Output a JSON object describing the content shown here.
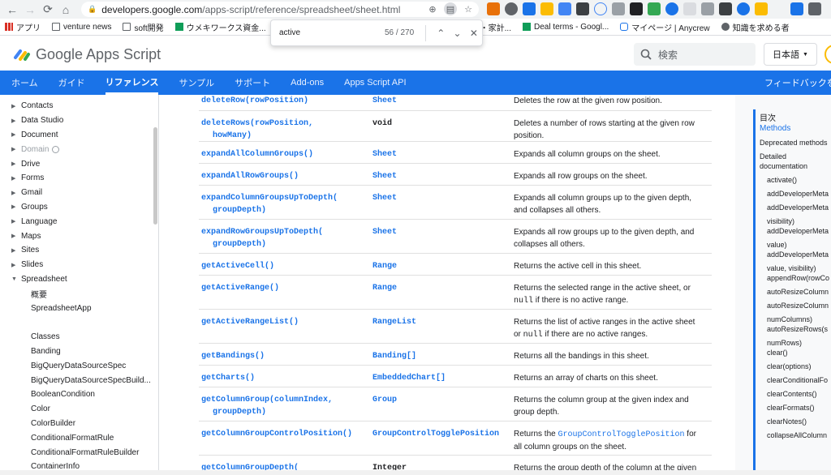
{
  "browser": {
    "url_host": "developers.google.com",
    "url_path": "/apps-script/reference/spreadsheet/sheet.html",
    "bookmarks": [
      "アプリ",
      "venture news",
      "soft開発",
      "ウメキワークス資金...",
      "プリ・家計...",
      "Deal terms - Googl...",
      "マイページ | Anycrew",
      "知識を求める者"
    ]
  },
  "find": {
    "query": "active",
    "count": "56 / 270"
  },
  "header": {
    "logo_text": "Google Apps Script",
    "search_placeholder": "検索",
    "language": "日本語"
  },
  "tabs": [
    "ホーム",
    "ガイド",
    "リファレンス",
    "サンプル",
    "サポート",
    "Add-ons",
    "Apps Script API"
  ],
  "feedback": "フィードバックを",
  "left_nav": [
    {
      "label": "Contacts",
      "arrow": true
    },
    {
      "label": "Data Studio",
      "arrow": true
    },
    {
      "label": "Document",
      "arrow": true
    },
    {
      "label": "Domain",
      "arrow": true,
      "disabled": true
    },
    {
      "label": "Drive",
      "arrow": true
    },
    {
      "label": "Forms",
      "arrow": true
    },
    {
      "label": "Gmail",
      "arrow": true
    },
    {
      "label": "Groups",
      "arrow": true
    },
    {
      "label": "Language",
      "arrow": true
    },
    {
      "label": "Maps",
      "arrow": true
    },
    {
      "label": "Sites",
      "arrow": true
    },
    {
      "label": "Slides",
      "arrow": true
    },
    {
      "label": "Spreadsheet",
      "arrow": true,
      "expanded": true
    },
    {
      "label": "概要",
      "sub": true
    },
    {
      "label": "SpreadsheetApp",
      "sub": true
    },
    {
      "label": "",
      "sub": true
    },
    {
      "label": "Classes",
      "sub": true
    },
    {
      "label": "Banding",
      "sub": true
    },
    {
      "label": "BigQueryDataSourceSpec",
      "sub": true
    },
    {
      "label": "BigQueryDataSourceSpecBuild...",
      "sub": true
    },
    {
      "label": "BooleanCondition",
      "sub": true
    },
    {
      "label": "Color",
      "sub": true
    },
    {
      "label": "ColorBuilder",
      "sub": true
    },
    {
      "label": "ConditionalFormatRule",
      "sub": true
    },
    {
      "label": "ConditionalFormatRuleBuilder",
      "sub": true
    },
    {
      "label": "ContainerInfo",
      "sub": true
    }
  ],
  "methods": [
    {
      "name": "deleteRow(rowPosition)",
      "name2": "",
      "type": "Sheet",
      "type_link": true,
      "desc": "Deletes the row at the given row position.",
      "desc2": ""
    },
    {
      "name": "deleteRows(rowPosition,",
      "name2": "howMany)",
      "type": "void",
      "type_link": false,
      "desc": "Deletes a number of rows starting at the given row",
      "desc2": "position."
    },
    {
      "name": "expandAllColumnGroups()",
      "name2": "",
      "type": "Sheet",
      "type_link": true,
      "desc": "Expands all column groups on the sheet.",
      "desc2": ""
    },
    {
      "name": "expandAllRowGroups()",
      "name2": "",
      "type": "Sheet",
      "type_link": true,
      "desc": "Expands all row groups on the sheet.",
      "desc2": ""
    },
    {
      "name": "expandColumnGroupsUpToDepth(",
      "name2": "groupDepth)",
      "type": "Sheet",
      "type_link": true,
      "desc": "Expands all column groups up to the given depth,",
      "desc2": "and collapses all others."
    },
    {
      "name": "expandRowGroupsUpToDepth(",
      "name2": "groupDepth)",
      "type": "Sheet",
      "type_link": true,
      "desc": "Expands all row groups up to the given depth, and",
      "desc2": "collapses all others."
    },
    {
      "name": "getActiveCell()",
      "name2": "",
      "type": "Range",
      "type_link": true,
      "desc": "Returns the active cell in this sheet.",
      "desc2": ""
    },
    {
      "name": "getActiveRange()",
      "name2": "",
      "type": "Range",
      "type_link": true,
      "desc": "Returns the selected range in the active sheet, or",
      "desc2_code": "null",
      "desc2": " if there is no active range."
    },
    {
      "name": "getActiveRangeList()",
      "name2": "",
      "type": "RangeList",
      "type_link": true,
      "desc": "Returns the list of active ranges in the active sheet",
      "desc2_pre": "or ",
      "desc2_code": "null",
      "desc2": " if there are no active ranges."
    },
    {
      "name": "getBandings()",
      "name2": "",
      "type": "Banding[]",
      "type_link": true,
      "desc": "Returns all the bandings in this sheet.",
      "desc2": ""
    },
    {
      "name": "getCharts()",
      "name2": "",
      "type": "EmbeddedChart[]",
      "type_link": true,
      "desc": "Returns an array of charts on this sheet.",
      "desc2": ""
    },
    {
      "name": "getColumnGroup(columnIndex,",
      "name2": "groupDepth)",
      "type": "Group",
      "type_link": true,
      "desc": "Returns the column group at the given index and",
      "desc2": "group depth."
    },
    {
      "name": "getColumnGroupControlPosition()",
      "name2": "",
      "type": "GroupControlTogglePosition",
      "type_link": true,
      "desc_pre": "Returns the ",
      "desc_link": "GroupControlTogglePosition",
      "desc": " for",
      "desc2": "all column groups on the sheet."
    },
    {
      "name": "getColumnGroupDepth(",
      "name2": "",
      "type": "Integer",
      "type_link": false,
      "desc": "Returns the group depth of the column at the given",
      "desc2": ""
    }
  ],
  "toc": {
    "title": "目次",
    "items": [
      {
        "label": "Methods",
        "active": true
      },
      {
        "label": "Deprecated methods"
      },
      {
        "label": "Detailed"
      },
      {
        "label": "documentation"
      },
      {
        "label": "activate()",
        "indent": true
      },
      {
        "label": "addDeveloperMeta",
        "indent": true
      },
      {
        "label": "addDeveloperMeta",
        "indent": true
      },
      {
        "label": "visibility)",
        "indent": true
      },
      {
        "label": "addDeveloperMeta",
        "indent": true
      },
      {
        "label": "value)",
        "indent": true
      },
      {
        "label": "addDeveloperMeta",
        "indent": true
      },
      {
        "label": "value, visibility)",
        "indent": true
      },
      {
        "label": "appendRow(rowCo",
        "indent": true
      },
      {
        "label": "autoResizeColumn",
        "indent": true
      },
      {
        "label": "autoResizeColumn",
        "indent": true
      },
      {
        "label": "numColumns)",
        "indent": true
      },
      {
        "label": "autoResizeRows(s",
        "indent": true
      },
      {
        "label": "numRows)",
        "indent": true
      },
      {
        "label": "clear()",
        "indent": true
      },
      {
        "label": "clear(options)",
        "indent": true
      },
      {
        "label": "clearConditionalFo",
        "indent": true
      },
      {
        "label": "clearContents()",
        "indent": true
      },
      {
        "label": "clearFormats()",
        "indent": true
      },
      {
        "label": "clearNotes()",
        "indent": true
      },
      {
        "label": "collapseAllColumn",
        "indent": true
      }
    ]
  }
}
